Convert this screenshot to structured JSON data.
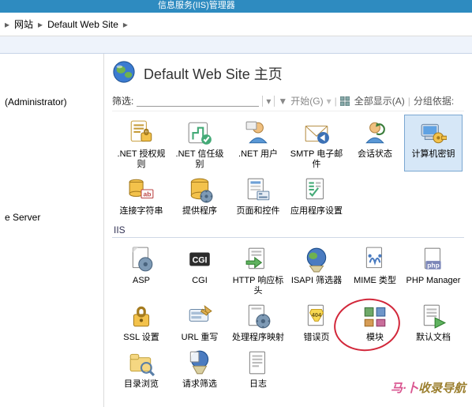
{
  "titlebar": {
    "text": "信息服务(IIS)管理器"
  },
  "breadcrumb": {
    "items": [
      "网站",
      "Default Web Site"
    ],
    "separator": "▸"
  },
  "left_pane": {
    "items": [
      "(Administrator)",
      "e Server"
    ]
  },
  "page": {
    "title": "Default Web Site 主页"
  },
  "filter": {
    "label": "筛选:",
    "placeholder": "",
    "go_label": "开始(G)",
    "show_all_label": "全部显示(A)",
    "group_by_label": "分组依据:"
  },
  "groups": [
    {
      "name": null,
      "items": [
        {
          "id": "net-authorization",
          "label": ".NET 授权规则"
        },
        {
          "id": "net-trust-levels",
          "label": ".NET 信任级别"
        },
        {
          "id": "net-users",
          "label": ".NET 用户"
        },
        {
          "id": "smtp-email",
          "label": "SMTP 电子邮件"
        },
        {
          "id": "session-state",
          "label": "会话状态"
        },
        {
          "id": "machine-key",
          "label": "计算机密钥",
          "selected": true
        },
        {
          "id": "connection-strings",
          "label": "连接字符串"
        },
        {
          "id": "providers",
          "label": "提供程序"
        },
        {
          "id": "pages-and-controls",
          "label": "页面和控件"
        },
        {
          "id": "application-settings",
          "label": "应用程序设置"
        }
      ]
    },
    {
      "name": "IIS",
      "items": [
        {
          "id": "asp",
          "label": "ASP"
        },
        {
          "id": "cgi",
          "label": "CGI"
        },
        {
          "id": "http-response-headers",
          "label": "HTTP 响应标头"
        },
        {
          "id": "isapi-filters",
          "label": "ISAPI 筛选器"
        },
        {
          "id": "mime-types",
          "label": "MIME 类型"
        },
        {
          "id": "php-manager",
          "label": "PHP Manager"
        },
        {
          "id": "ssl-settings",
          "label": "SSL 设置"
        },
        {
          "id": "url-rewrite",
          "label": "URL 重写",
          "highlighted": true
        },
        {
          "id": "handler-mappings",
          "label": "处理程序映射"
        },
        {
          "id": "error-pages",
          "label": "错误页"
        },
        {
          "id": "modules",
          "label": "模块"
        },
        {
          "id": "default-document",
          "label": "默认文档"
        },
        {
          "id": "directory-browsing",
          "label": "目录浏览"
        },
        {
          "id": "request-filtering",
          "label": "请求筛选"
        },
        {
          "id": "logging",
          "label": "日志"
        }
      ]
    }
  ],
  "watermark": {
    "text_a": "马·卜",
    "text_b": "收录导航"
  }
}
